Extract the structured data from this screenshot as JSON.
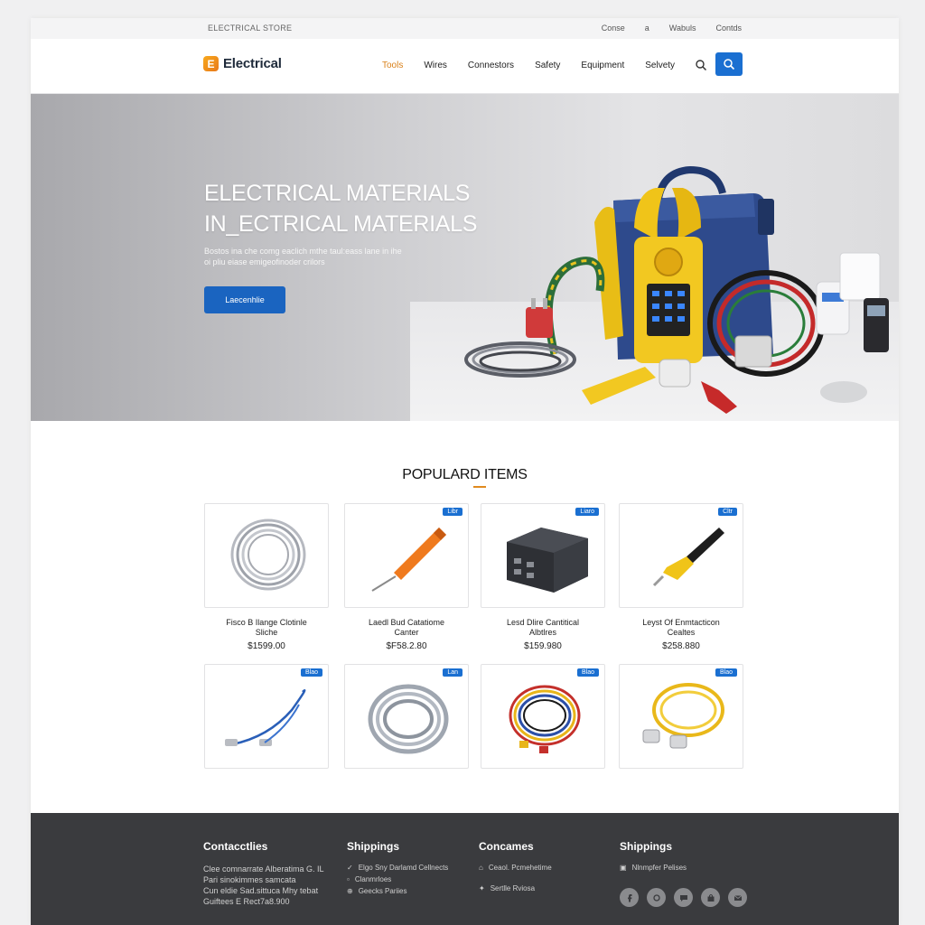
{
  "utility": {
    "brand": "ELECTRICAL STORE",
    "links": [
      "Conse",
      "a",
      "Wabuls",
      "Contds"
    ]
  },
  "header": {
    "logo_letter": "E",
    "logo_text": "Electrical",
    "nav": [
      "Tools",
      "Wires",
      "Connestors",
      "Safety",
      "Equipment",
      "Selvety"
    ],
    "active_nav": "Tools"
  },
  "hero": {
    "title_line1": "ELECTRICAL MATERIALS",
    "title_line2": "IN_ECTRICAL MATERIALS",
    "desc_line1": "Bostos ina che comg eaclich mthe taul:eass lane in ihe",
    "desc_line2": "oi pliu eiase emigeofinoder crilors",
    "cta": "Laecenhlie"
  },
  "popular": {
    "title": "POPULARD ITEMS",
    "products": [
      {
        "badge": "",
        "name1": "Fisco B Ilange Clotinle",
        "name2": "Sliche",
        "price": "$1599.00",
        "icon": "coiled-cable-icon"
      },
      {
        "badge": "Libr",
        "name1": "Laedl Bud Catatiome",
        "name2": "Canter",
        "price": "$F58.2.80",
        "icon": "screwdriver-icon"
      },
      {
        "badge": "Liaro",
        "name1": "Lesd Dlire Cantitical",
        "name2": "Albtlres",
        "price": "$159.980",
        "icon": "junction-box-icon"
      },
      {
        "badge": "Cltr",
        "name1": "Leyst Of Enmtacticon",
        "name2": "Cealtes",
        "price": "$258.880",
        "icon": "voltage-tester-icon"
      },
      {
        "badge": "Blao",
        "name1": "",
        "name2": "",
        "price": "",
        "icon": "blue-cable-icon"
      },
      {
        "badge": "Lan",
        "name1": "",
        "name2": "",
        "price": "",
        "icon": "gray-cable-icon"
      },
      {
        "badge": "Blao",
        "name1": "",
        "name2": "",
        "price": "",
        "icon": "colored-wires-icon"
      },
      {
        "badge": "Blao",
        "name1": "",
        "name2": "",
        "price": "",
        "icon": "yellow-extension-cord-icon"
      }
    ]
  },
  "footer": {
    "col1": {
      "title": "Contacctlies",
      "lines": [
        "Clee comnarrate Alberatima G. IL",
        "Pari sinokimmes samcata",
        "Cun eldie Sad.sittuca Mhy tebat",
        "Guiftees E Rect7a8.900"
      ]
    },
    "col2": {
      "title": "Shippings",
      "items": [
        "Elgo Sny Darlamd Cellnects",
        "Clanmrloes",
        "Geecks Pariies"
      ]
    },
    "col3": {
      "title": "Concames",
      "items": [
        "Ceaol. Pcmehetime",
        "Sertlle Rviosa"
      ]
    },
    "col4": {
      "title": "Shippings",
      "items": [
        "Nlnmpfer Pelises"
      ]
    },
    "socials": [
      "facebook-icon",
      "camera-icon",
      "chat-icon",
      "bag-icon",
      "mail-icon"
    ]
  },
  "colors": {
    "accent_orange": "#e08a1e",
    "primary_blue": "#1a6fd1",
    "footer_bg": "#3a3b3e"
  }
}
